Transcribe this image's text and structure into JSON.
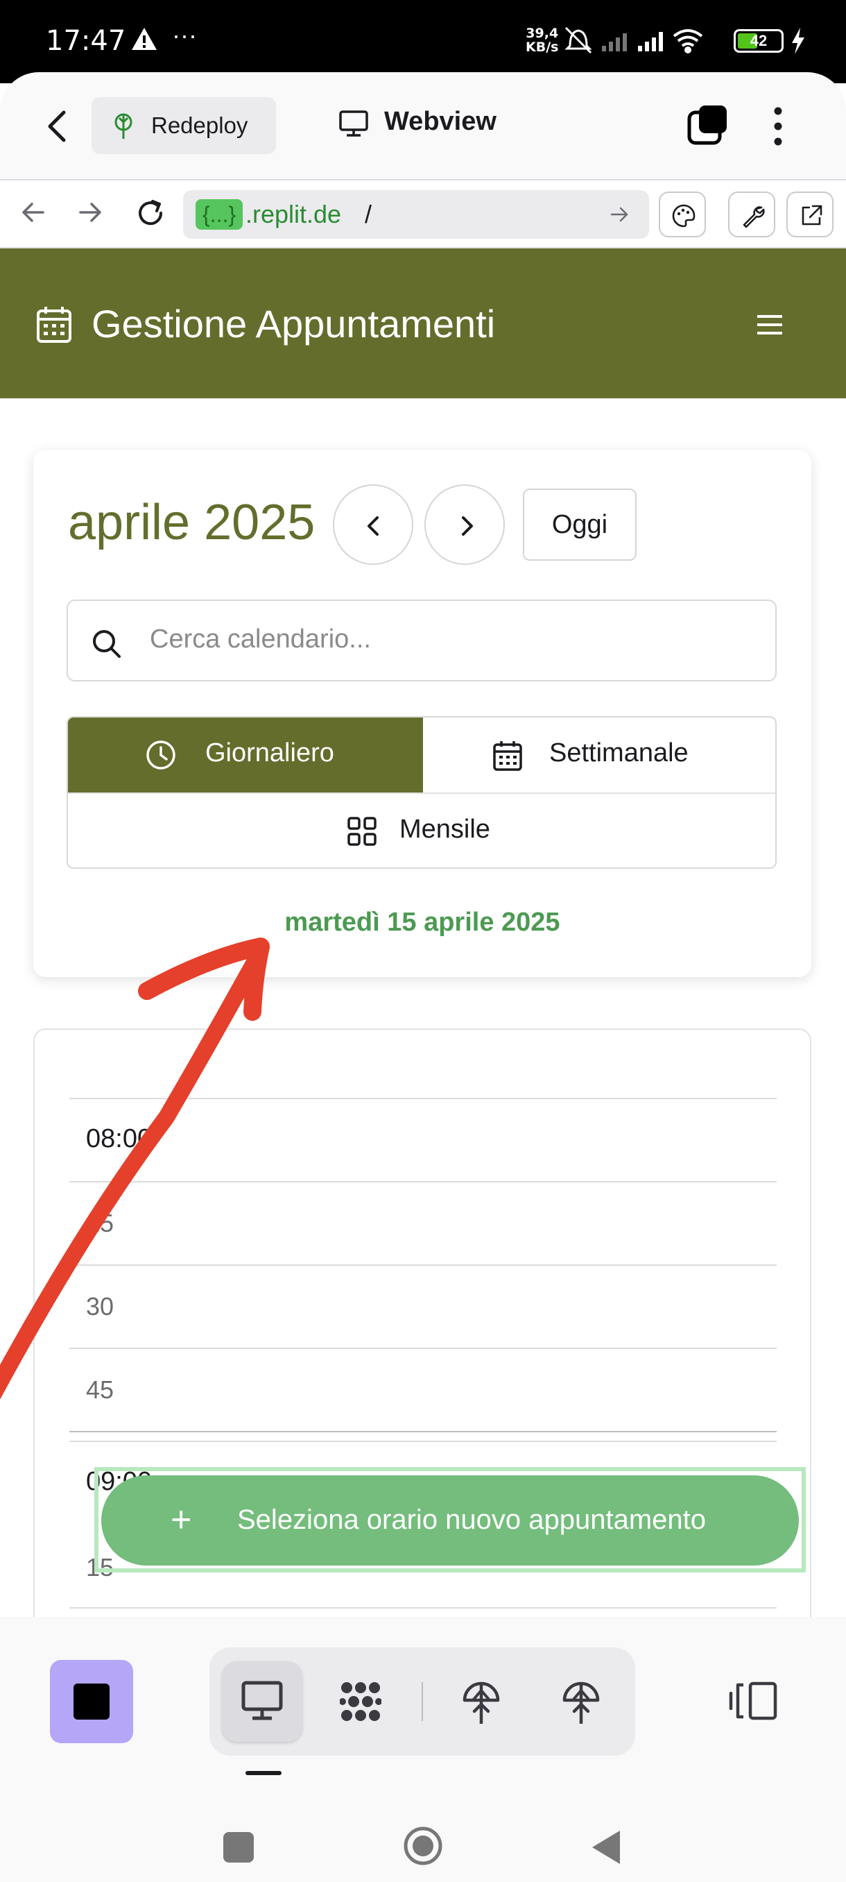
{
  "status_bar": {
    "time": "17:47",
    "more": "···",
    "net_speed_value": "39,4",
    "net_speed_unit": "KB/s",
    "battery": "42"
  },
  "replit": {
    "redeploy_label": "Redeploy",
    "tab_label": "Webview",
    "url_badge": "{...}",
    "url_domain": ".replit.de",
    "url_path": "/"
  },
  "app": {
    "title": "Gestione Appuntamenti",
    "month_title": "aprile 2025",
    "today_label": "Oggi",
    "search_placeholder": "Cerca calendario...",
    "views": {
      "daily": "Giornaliero",
      "weekly": "Settimanale",
      "monthly": "Mensile"
    },
    "current_date": "martedì 15 aprile 2025",
    "slots": [
      "08:00",
      "15",
      "30",
      "45",
      "09:00",
      "15"
    ],
    "fab_plus": "+",
    "fab_label": "Seleziona orario nuovo appuntamento"
  },
  "colors": {
    "brand_olive": "#646d2c",
    "date_green": "#4c9a52",
    "fab_green": "#74bd7d",
    "annotation_red": "#e5402b",
    "stop_purple": "#b5a6f8"
  },
  "icons": {
    "header_calendar": "calendar-icon",
    "menu": "hamburger-icon",
    "search": "search-icon",
    "daily": "clock-icon",
    "weekly": "calendar-icon",
    "monthly": "grid-icon"
  }
}
